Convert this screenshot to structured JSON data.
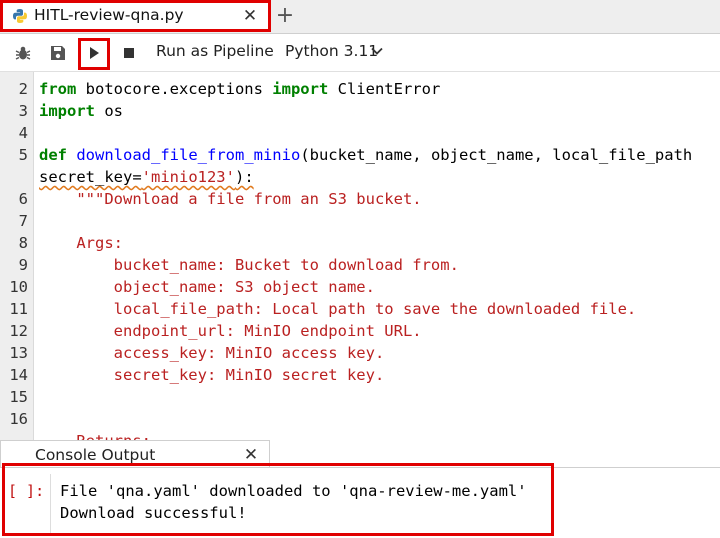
{
  "tab": {
    "title": "HITL-review-qna.py",
    "close": "✕",
    "new_tab": "+"
  },
  "toolbar": {
    "run_pipeline_label": "Run as Pipeline",
    "kernel_label": "Python 3.11"
  },
  "editor": {
    "lines": [
      {
        "n": "2",
        "segs": [
          [
            "kw",
            "from"
          ],
          [
            "plain",
            " botocore.exceptions "
          ],
          [
            "kw",
            "import"
          ],
          [
            "plain",
            " ClientError"
          ]
        ]
      },
      {
        "n": "3",
        "segs": [
          [
            "kw",
            "import"
          ],
          [
            "plain",
            " os"
          ]
        ]
      },
      {
        "n": "4",
        "segs": []
      },
      {
        "n": "5",
        "segs": [
          [
            "kw",
            "def"
          ],
          [
            "plain",
            " "
          ],
          [
            "fn",
            "download_file_from_minio"
          ],
          [
            "plain",
            "(bucket_name, object_name, local_file_path"
          ]
        ]
      },
      {
        "n": "",
        "segs": [
          [
            "plain",
            "secret_key="
          ],
          [
            "str",
            "'minio123'"
          ],
          [
            "plain",
            "):"
          ]
        ],
        "squiggle": true
      },
      {
        "n": "6",
        "segs": [
          [
            "str",
            "    \"\"\"Download a file from an S3 bucket."
          ]
        ]
      },
      {
        "n": "7",
        "segs": []
      },
      {
        "n": "8",
        "segs": [
          [
            "str",
            "    Args:"
          ]
        ]
      },
      {
        "n": "9",
        "segs": [
          [
            "str",
            "        bucket_name: Bucket to download from."
          ]
        ]
      },
      {
        "n": "10",
        "segs": [
          [
            "str",
            "        object_name: S3 object name."
          ]
        ]
      },
      {
        "n": "11",
        "segs": [
          [
            "str",
            "        local_file_path: Local path to save the downloaded file."
          ]
        ]
      },
      {
        "n": "12",
        "segs": [
          [
            "str",
            "        endpoint_url: MinIO endpoint URL."
          ]
        ]
      },
      {
        "n": "13",
        "segs": [
          [
            "str",
            "        access_key: MinIO access key."
          ]
        ]
      },
      {
        "n": "14",
        "segs": [
          [
            "str",
            "        secret_key: MinIO secret key."
          ]
        ]
      },
      {
        "n": "15",
        "segs": []
      },
      {
        "n": "16",
        "segs": []
      },
      {
        "n": "",
        "segs": [
          [
            "str",
            "    Returns:"
          ]
        ]
      }
    ]
  },
  "console": {
    "title": "Console Output",
    "close": "✕",
    "prompt": "[ ]:",
    "output": [
      "File 'qna.yaml' downloaded to 'qna-review-me.yaml'",
      "Download successful!"
    ]
  }
}
